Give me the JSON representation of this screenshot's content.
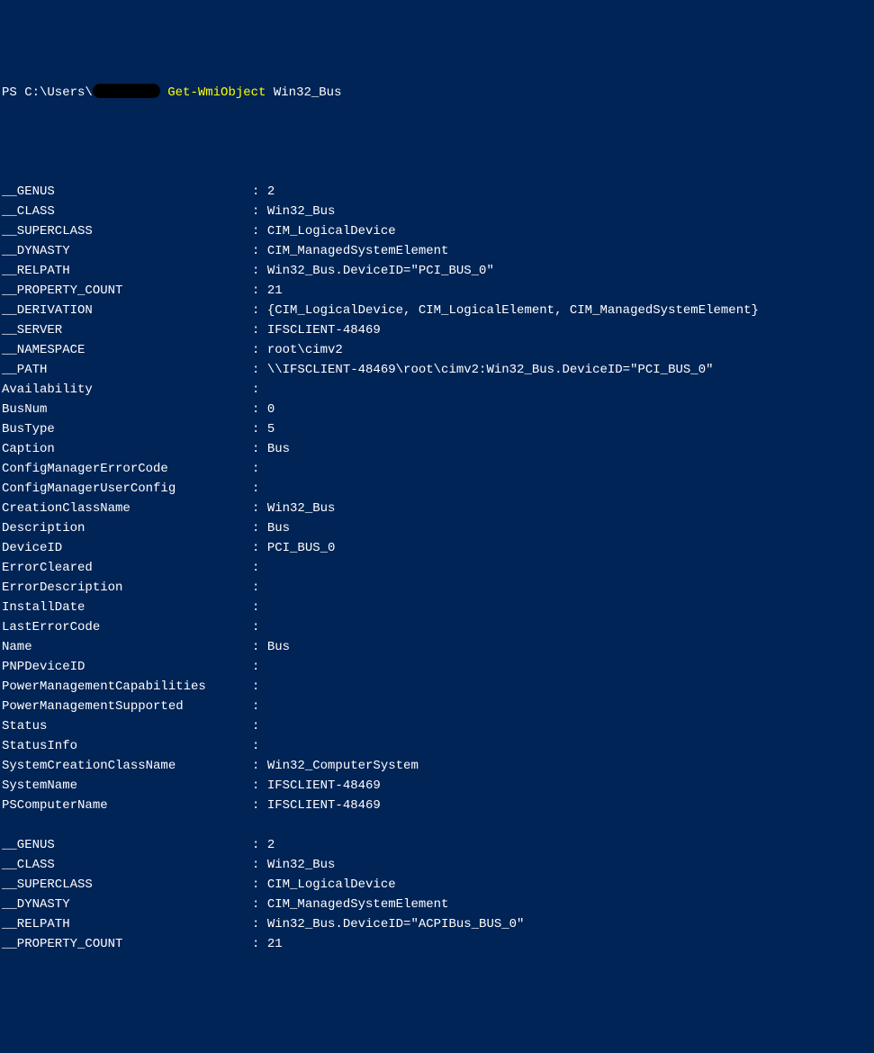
{
  "prompt": {
    "prefix": "PS C:\\Users\\",
    "cmdlet": "Get-WmiObject",
    "argument": "Win32_Bus"
  },
  "blocks": [
    {
      "rows": [
        {
          "name": "__GENUS",
          "value": "2"
        },
        {
          "name": "__CLASS",
          "value": "Win32_Bus"
        },
        {
          "name": "__SUPERCLASS",
          "value": "CIM_LogicalDevice"
        },
        {
          "name": "__DYNASTY",
          "value": "CIM_ManagedSystemElement"
        },
        {
          "name": "__RELPATH",
          "value": "Win32_Bus.DeviceID=\"PCI_BUS_0\""
        },
        {
          "name": "__PROPERTY_COUNT",
          "value": "21"
        },
        {
          "name": "__DERIVATION",
          "value": "{CIM_LogicalDevice, CIM_LogicalElement, CIM_ManagedSystemElement}"
        },
        {
          "name": "__SERVER",
          "value": "IFSCLIENT-48469"
        },
        {
          "name": "__NAMESPACE",
          "value": "root\\cimv2"
        },
        {
          "name": "__PATH",
          "value": "\\\\IFSCLIENT-48469\\root\\cimv2:Win32_Bus.DeviceID=\"PCI_BUS_0\""
        },
        {
          "name": "Availability",
          "value": ""
        },
        {
          "name": "BusNum",
          "value": "0"
        },
        {
          "name": "BusType",
          "value": "5"
        },
        {
          "name": "Caption",
          "value": "Bus"
        },
        {
          "name": "ConfigManagerErrorCode",
          "value": ""
        },
        {
          "name": "ConfigManagerUserConfig",
          "value": ""
        },
        {
          "name": "CreationClassName",
          "value": "Win32_Bus"
        },
        {
          "name": "Description",
          "value": "Bus"
        },
        {
          "name": "DeviceID",
          "value": "PCI_BUS_0"
        },
        {
          "name": "ErrorCleared",
          "value": ""
        },
        {
          "name": "ErrorDescription",
          "value": ""
        },
        {
          "name": "InstallDate",
          "value": ""
        },
        {
          "name": "LastErrorCode",
          "value": ""
        },
        {
          "name": "Name",
          "value": "Bus"
        },
        {
          "name": "PNPDeviceID",
          "value": ""
        },
        {
          "name": "PowerManagementCapabilities",
          "value": ""
        },
        {
          "name": "PowerManagementSupported",
          "value": ""
        },
        {
          "name": "Status",
          "value": ""
        },
        {
          "name": "StatusInfo",
          "value": ""
        },
        {
          "name": "SystemCreationClassName",
          "value": "Win32_ComputerSystem"
        },
        {
          "name": "SystemName",
          "value": "IFSCLIENT-48469"
        },
        {
          "name": "PSComputerName",
          "value": "IFSCLIENT-48469"
        }
      ]
    },
    {
      "rows": [
        {
          "name": "__GENUS",
          "value": "2"
        },
        {
          "name": "__CLASS",
          "value": "Win32_Bus"
        },
        {
          "name": "__SUPERCLASS",
          "value": "CIM_LogicalDevice"
        },
        {
          "name": "__DYNASTY",
          "value": "CIM_ManagedSystemElement"
        },
        {
          "name": "__RELPATH",
          "value": "Win32_Bus.DeviceID=\"ACPIBus_BUS_0\""
        },
        {
          "name": "__PROPERTY_COUNT",
          "value": "21"
        }
      ]
    }
  ]
}
